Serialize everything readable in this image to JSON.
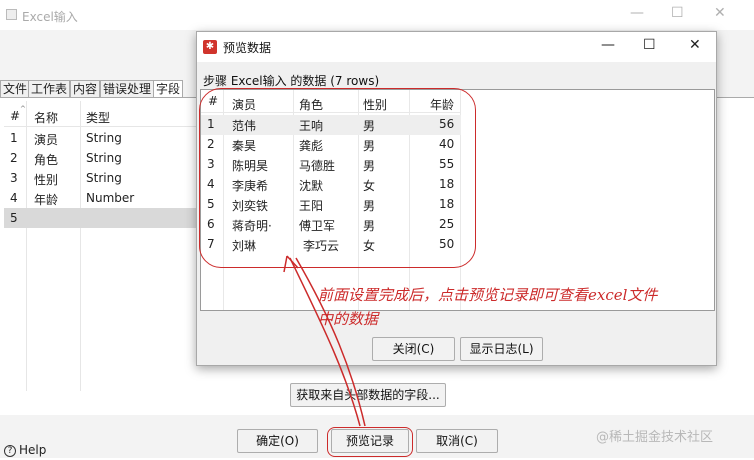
{
  "bg_window": {
    "title": "Excel输入",
    "controls": {
      "minimize": "—",
      "maximize": "☐",
      "close": "✕"
    },
    "tabs": [
      "文件",
      "工作表",
      "内容",
      "错误处理",
      "字段"
    ],
    "grid": {
      "headers": [
        "#",
        "名称",
        "类型"
      ],
      "rows": [
        {
          "num": "1",
          "name": "演员",
          "type": "String"
        },
        {
          "num": "2",
          "name": "角色",
          "type": "String"
        },
        {
          "num": "3",
          "name": "性别",
          "type": "String"
        },
        {
          "num": "4",
          "name": "年龄",
          "type": "Number"
        },
        {
          "num": "5",
          "name": "",
          "type": ""
        }
      ]
    },
    "get_fields_button": "获取来自头部数据的字段...",
    "ok_button": "确定(O)",
    "preview_button": "预览记录",
    "cancel_button": "取消(C)",
    "help_button": "Help",
    "help_icon": "?"
  },
  "dialog": {
    "title": "预览数据",
    "icon_glyph": "✱",
    "controls": {
      "minimize": "—",
      "maximize": "☐",
      "close": "✕"
    },
    "heading": "步骤 Excel输入 的数据 (7 rows)",
    "columns": [
      "#",
      "演员",
      "角色",
      "性别",
      "年龄"
    ],
    "rows": [
      {
        "num": "1",
        "actor": "范伟",
        "role": "王响",
        "gender": "男",
        "age": "56"
      },
      {
        "num": "2",
        "actor": "秦昊",
        "role": "龚彪",
        "gender": "男",
        "age": "40"
      },
      {
        "num": "3",
        "actor": "陈明昊",
        "role": "马德胜",
        "gender": "男",
        "age": "55"
      },
      {
        "num": "4",
        "actor": "李庚希",
        "role": "沈默",
        "gender": "女",
        "age": "18"
      },
      {
        "num": "5",
        "actor": "刘奕铁",
        "role": "王阳",
        "gender": "男",
        "age": "18"
      },
      {
        "num": "6",
        "actor": "蒋奇明·",
        "role": "傅卫军",
        "gender": "男",
        "age": "25"
      },
      {
        "num": "7",
        "actor": "刘琳",
        "role": "李巧云",
        "gender": "女",
        "age": "50"
      }
    ],
    "close_button": "关闭(C)",
    "show_log_button": "显示日志(L)"
  },
  "annotation": {
    "text_line1": "前面设置完成后，点击预览记录即可查看excel文件",
    "text_line2": "中的数据",
    "color": "#cc2b2b"
  },
  "watermark": "@稀土掘金技术社区"
}
